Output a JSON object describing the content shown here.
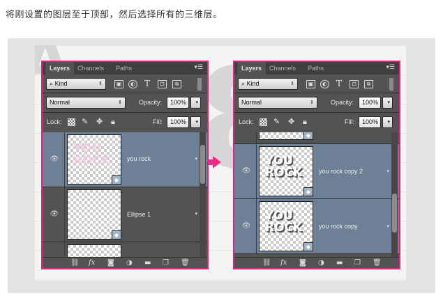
{
  "caption": "将刚设置的图层至于顶部，然后选择所有的三维层。",
  "panels": [
    {
      "tabs": [
        "Layers",
        "Channels",
        "Paths"
      ],
      "filter": "Kind",
      "blend_mode": "Normal",
      "opacity_label": "Opacity:",
      "opacity_value": "100%",
      "lock_label": "Lock:",
      "fill_label": "Fill:",
      "fill_value": "100%",
      "layers": [
        {
          "name": "you rock",
          "selected": true
        },
        {
          "name": "Ellipse 1",
          "selected": false
        },
        {
          "name": "",
          "selected": false
        }
      ]
    },
    {
      "tabs": [
        "Layers",
        "Channels",
        "Paths"
      ],
      "filter": "Kind",
      "blend_mode": "Normal",
      "opacity_label": "Opacity:",
      "opacity_value": "100%",
      "lock_label": "Lock:",
      "fill_label": "Fill:",
      "fill_value": "100%",
      "layers": [
        {
          "name": "",
          "selected": false
        },
        {
          "name": "you rock copy 2",
          "selected": true
        },
        {
          "name": "you rock copy",
          "selected": true
        }
      ]
    }
  ],
  "thumb_text": "YOU ROCK",
  "icons": {
    "eye": "eye-icon",
    "search": "search-icon",
    "menu": "panel-menu-icon"
  },
  "colors": {
    "highlight_border": "#e8227a",
    "arrow": "#ef2a86",
    "selected_layer": "#6e8096"
  }
}
